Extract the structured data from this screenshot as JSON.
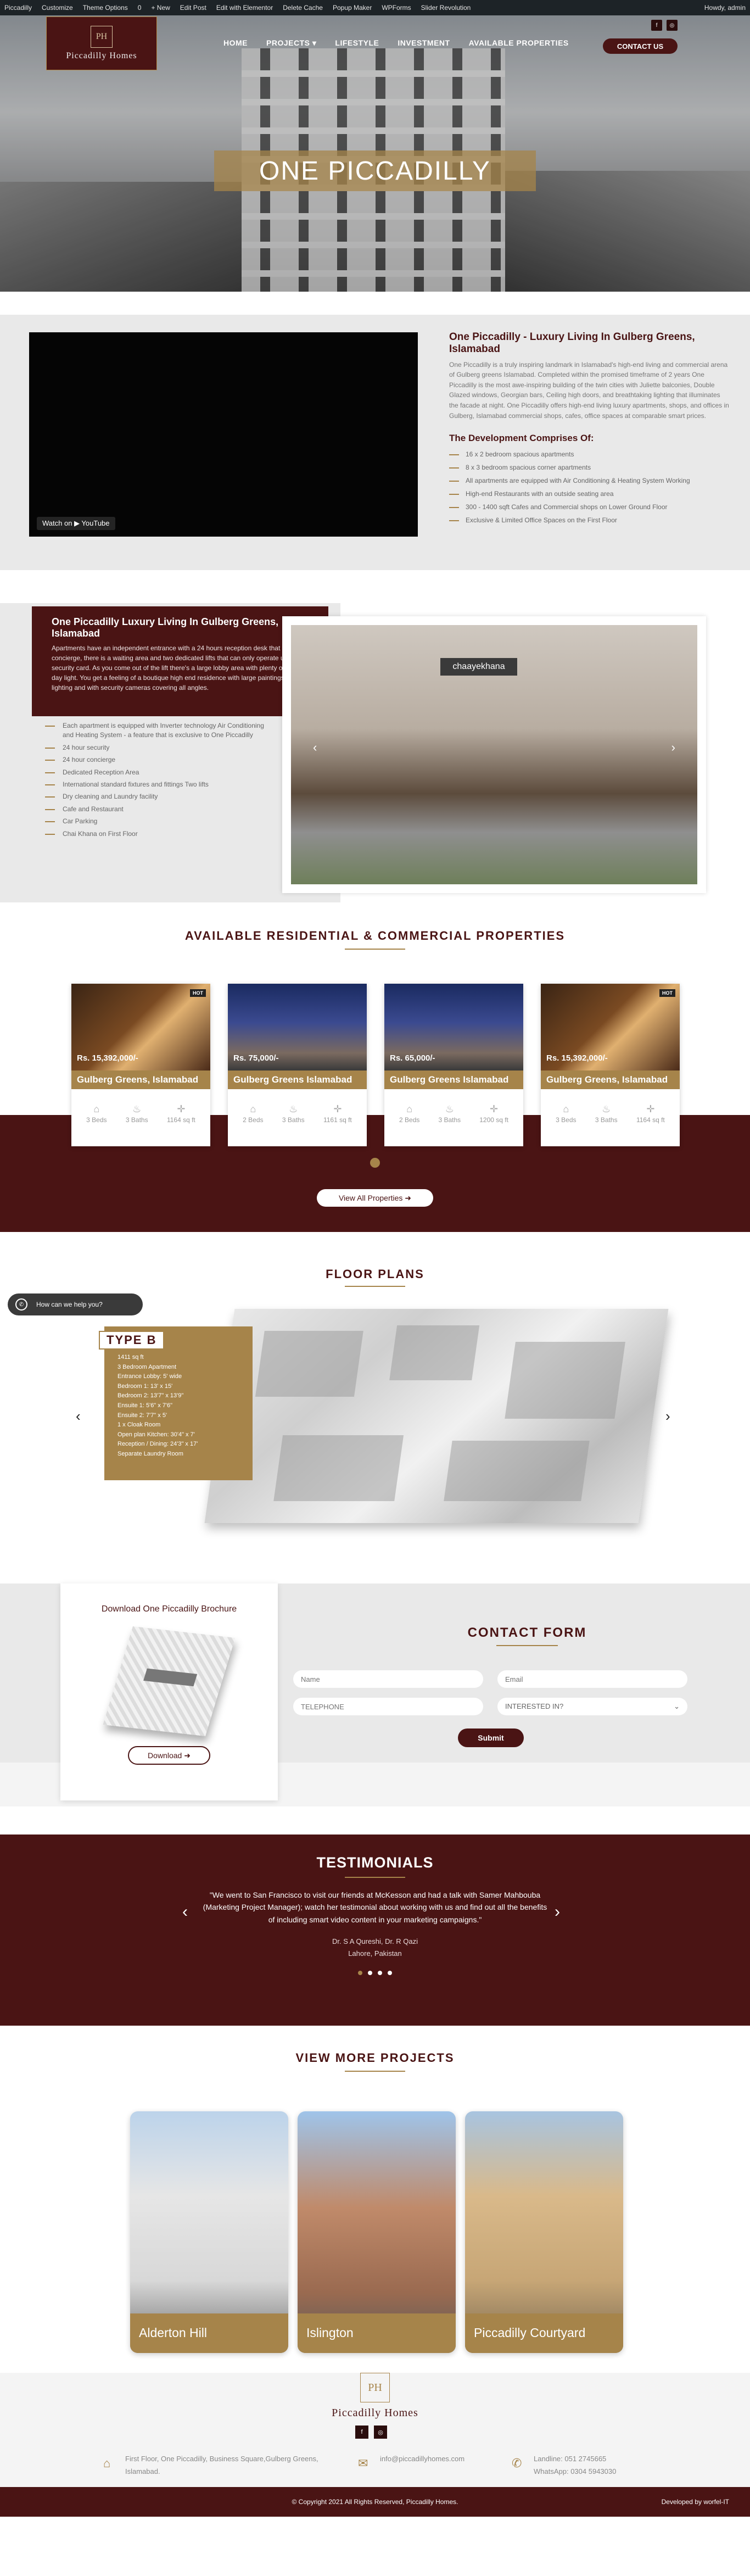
{
  "wpbar": {
    "items": [
      "Piccadilly",
      "Customize",
      "Theme Options",
      "0",
      "+ New",
      "Edit Post",
      "Edit with Elementor",
      "Delete Cache",
      "Popup Maker",
      "WPForms",
      "Slider Revolution"
    ],
    "howdy": "Howdy, admin"
  },
  "header": {
    "logo_mono": "PH",
    "logo_name": "Piccadilly Homes",
    "nav": [
      "HOME",
      "PROJECTS ▾",
      "LIFESTYLE",
      "INVESTMENT",
      "AVAILABLE PROPERTIES"
    ],
    "contact_button": "CONTACT US",
    "social_icons": [
      "facebook-icon",
      "instagram-icon"
    ]
  },
  "hero": {
    "title": "ONE PICCADILLY"
  },
  "intro": {
    "video_watch": "Watch on  ▶ YouTube",
    "heading": "One Piccadilly - Luxury Living In Gulberg Greens, Islamabad",
    "body": "One Piccadilly is a truly inspiring landmark in Islamabad's high-end living and commercial arena of Gulberg greens Islamabad. Completed within the promised timeframe of 2 years One Piccadilly is the most awe-inspiring building of the twin cities with Juliette balconies, Double Glazed windows, Georgian bars, Ceiling high doors, and breathtaking lighting that illuminates the facade at night. One Piccadilly offers high-end living luxury apartments, shops, and offices in Gulberg, Islamabad commercial shops, cafes, office spaces at comparable smart prices.",
    "sub_heading": "The Development Comprises Of:",
    "list": [
      "16 x 2 bedroom spacious apartments",
      "8 x 3 bedroom spacious corner apartments",
      "All apartments are equipped with Air Conditioning & Heating System Working",
      "High-end Restaurants with an outside seating area",
      "300 - 1400 sqft Cafes and Commercial shops on Lower Ground Floor",
      "Exclusive & Limited Office Spaces on the First Floor"
    ]
  },
  "luxury": {
    "heading": "One Piccadilly Luxury Living In Gulberg Greens, Islamabad",
    "body": "Apartments have an independent entrance with a 24 hours reception desk that acts as a concierge, there is a waiting area and two dedicated lifts that can only operate using a security card. As you come out of the lift there's a large lobby area with plenty of natural day light. You get a feeling of a boutique high end residence with large paintings, soft lighting and with security cameras covering all angles.",
    "list": [
      "Each apartment is equipped with Inverter technology Air Conditioning and Heating System - a feature that is exclusive to One Piccadilly",
      "24 hour security",
      "24 hour concierge",
      "Dedicated Reception Area",
      "International standard fixtures and fittings Two lifts",
      "Dry cleaning and Laundry facility",
      "Cafe and Restaurant",
      "Car Parking",
      "Chai Khana on First Floor"
    ],
    "shop_sign": "chaayekhana"
  },
  "properties": {
    "title": "AVAILABLE RESIDENTIAL & COMMERCIAL PROPERTIES",
    "cards": [
      {
        "price": "Rs. 15,392,000/-",
        "title": "Gulberg Greens, Islamabad",
        "hot": "HOT",
        "beds": "3 Beds",
        "baths": "3 Baths",
        "area": "1164 sq ft"
      },
      {
        "price": "Rs. 75,000/-",
        "title": "Gulberg Greens Islamabad",
        "hot": "",
        "beds": "2 Beds",
        "baths": "3 Baths",
        "area": "1161 sq ft"
      },
      {
        "price": "Rs. 65,000/-",
        "title": "Gulberg Greens Islamabad",
        "hot": "",
        "beds": "2 Beds",
        "baths": "3 Baths",
        "area": "1200 sq ft"
      },
      {
        "price": "Rs. 15,392,000/-",
        "title": "Gulberg Greens, Islamabad",
        "hot": "HOT",
        "beds": "3 Beds",
        "baths": "3 Baths",
        "area": "1164 sq ft"
      }
    ],
    "view_all": "View All Properties ➜"
  },
  "floor": {
    "title": "FLOOR PLANS",
    "help": "How can we help you?",
    "type_tag": "TYPE B",
    "type_list": [
      "1411 sq ft",
      "3 Bedroom Apartment",
      "Entrance Lobby: 5' wide",
      "Bedroom 1: 13' x 15'",
      "Bedroom 2: 13'7\" x 13'9\"",
      "Ensuite 1: 5'6\" x 7'6\"",
      "Ensuite 2: 7'7\" x 5'",
      "1 x Cloak Room",
      "Open plan Kitchen: 30'4\" x 7'",
      "Reception / Dining: 24'3\" x 17'",
      "Separate Laundry Room"
    ]
  },
  "contact": {
    "brochure_title": "Download One Piccadilly Brochure",
    "download": "Download ➜",
    "form_title": "CONTACT FORM",
    "name_ph": "Name",
    "email_ph": "Email",
    "phone_ph": "TELEPHONE",
    "interest_ph": "INTERESTED IN?",
    "submit": "Submit"
  },
  "testimonials": {
    "title": "TESTIMONIALS",
    "quote": "\"We went to San Francisco to visit our friends at McKesson and had a talk with Samer Mahbouba (Marketing Project Manager); watch her testimonial about working with us and find out all the benefits of including smart video content in your marketing campaigns.\"",
    "author": "Dr. S A Qureshi, Dr. R Qazi",
    "location": "Lahore, Pakistan"
  },
  "more": {
    "title": "VIEW MORE PROJECTS",
    "projects": [
      "Alderton Hill",
      "Islington",
      "Piccadilly Courtyard"
    ]
  },
  "footer": {
    "logo_mono": "PH",
    "logo_name": "Piccadilly Homes",
    "address": "First Floor, One Piccadilly, Business Square,Gulberg Greens, Islamabad.",
    "email": "info@piccadillyhomes.com",
    "landline": "Landline:   051 2745665",
    "whatsapp": "WhatsApp: 0304 5943030",
    "copyright": "© Copyright 2021 All Rights Reserved, Piccadilly Homes.",
    "developed": "Developed by  worfel-IT"
  },
  "colors": {
    "maroon": "#4a1414",
    "gold": "#a6844a"
  }
}
